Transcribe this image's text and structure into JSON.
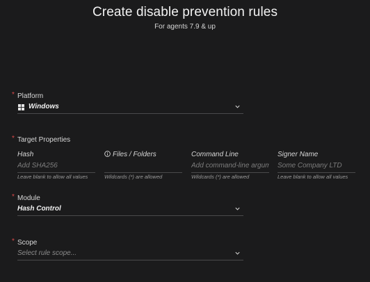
{
  "header": {
    "title": "Create disable prevention rules",
    "subtitle": "For agents 7.9 & up"
  },
  "platform": {
    "label": "Platform",
    "required_mark": "*",
    "value": "Windows",
    "icon": "windows-icon"
  },
  "target_properties": {
    "label": "Target Properties",
    "required_mark": "*",
    "fields": [
      {
        "label": "Hash",
        "placeholder": "Add SHA256",
        "hint": "Leave blank to allow all values"
      },
      {
        "label": "Files / Folders",
        "placeholder": "",
        "hint": "Wildcards (*) are allowed",
        "icon": "info-icon"
      },
      {
        "label": "Command Line",
        "placeholder": "Add command-line argum",
        "hint": "Wildcards (*) are allowed"
      },
      {
        "label": "Signer Name",
        "placeholder": "Some Company LTD",
        "hint": "Leave blank to allow all values"
      }
    ]
  },
  "module": {
    "label": "Module",
    "required_mark": "*",
    "value": "Hash Control"
  },
  "scope": {
    "label": "Scope",
    "required_mark": "*",
    "placeholder": "Select rule scope..."
  },
  "colors": {
    "background": "#1b1b1c",
    "required": "#d94a4a",
    "underline": "#4a4a4c"
  }
}
